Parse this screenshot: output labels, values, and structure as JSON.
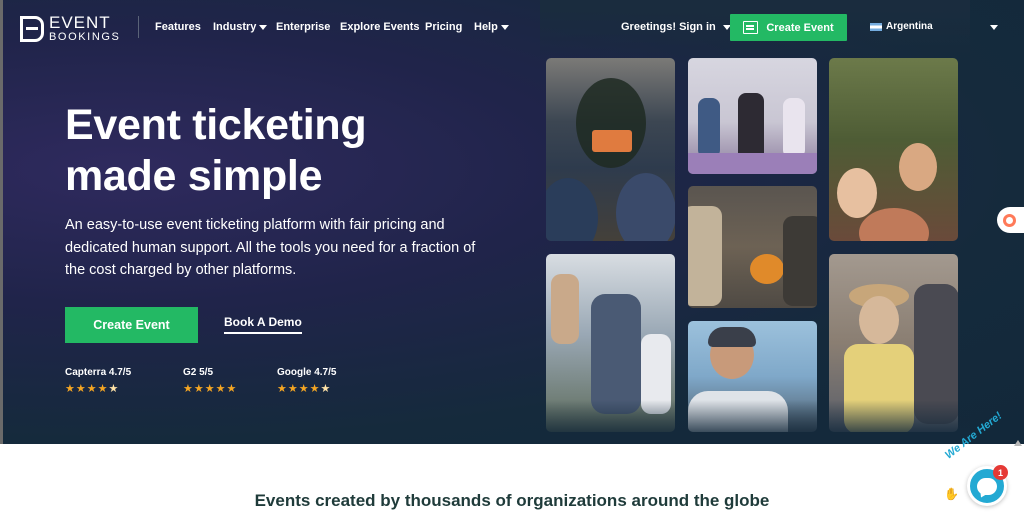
{
  "brand": {
    "line1": "EVENT",
    "line2": "BOOKINGS",
    "accent": "#23b964"
  },
  "nav": {
    "links": [
      {
        "label": "Features",
        "dropdown": false
      },
      {
        "label": "Industry",
        "dropdown": true
      },
      {
        "label": "Enterprise",
        "dropdown": false
      },
      {
        "label": "Explore Events",
        "dropdown": false
      },
      {
        "label": "Pricing",
        "dropdown": false
      },
      {
        "label": "Help",
        "dropdown": true
      }
    ],
    "signin": "Greetings! Sign in",
    "cta": "Create Event",
    "country": "Argentina"
  },
  "hero": {
    "title_line1": "Event ticketing",
    "title_line2": "made simple",
    "subtitle": "An easy-to-use event ticketing platform with fair pricing and dedicated human support. All the tools you need for a fraction of the cost charged by other platforms.",
    "primary_button": "Create Event",
    "secondary_button": "Book A Demo"
  },
  "ratings": [
    {
      "name": "Capterra 4.7/5",
      "score": 4.7
    },
    {
      "name": "G2 5/5",
      "score": 5
    },
    {
      "name": "Google 4.7/5",
      "score": 4.7
    }
  ],
  "photos": [
    {
      "name": "photo-outdoor-concert",
      "colors": [
        "#2e3b4d",
        "#8a5a3a",
        "#c9783f"
      ]
    },
    {
      "name": "photo-yoga-class",
      "colors": [
        "#c9c6d3",
        "#7f6f7a",
        "#e9e4ee"
      ]
    },
    {
      "name": "photo-festival-crowd",
      "colors": [
        "#5a6a3a",
        "#c07a5a",
        "#e7c0a0"
      ]
    },
    {
      "name": "photo-pumpkin-market",
      "colors": [
        "#4f4a44",
        "#e08a2a",
        "#c2b39a"
      ]
    },
    {
      "name": "photo-family-outdoors",
      "colors": [
        "#9aa8b5",
        "#4a5a74",
        "#d9c9b8"
      ]
    },
    {
      "name": "photo-cyclist",
      "colors": [
        "#7fa8c9",
        "#3a3f4a",
        "#c89a7a"
      ]
    },
    {
      "name": "photo-woman-with-hat",
      "colors": [
        "#9a8a7a",
        "#d6b89a",
        "#5a5f6a"
      ]
    }
  ],
  "lower": {
    "title": "Events created by thousands of organizations around the globe"
  },
  "chat": {
    "text": "We Are Here!",
    "count": "1"
  }
}
